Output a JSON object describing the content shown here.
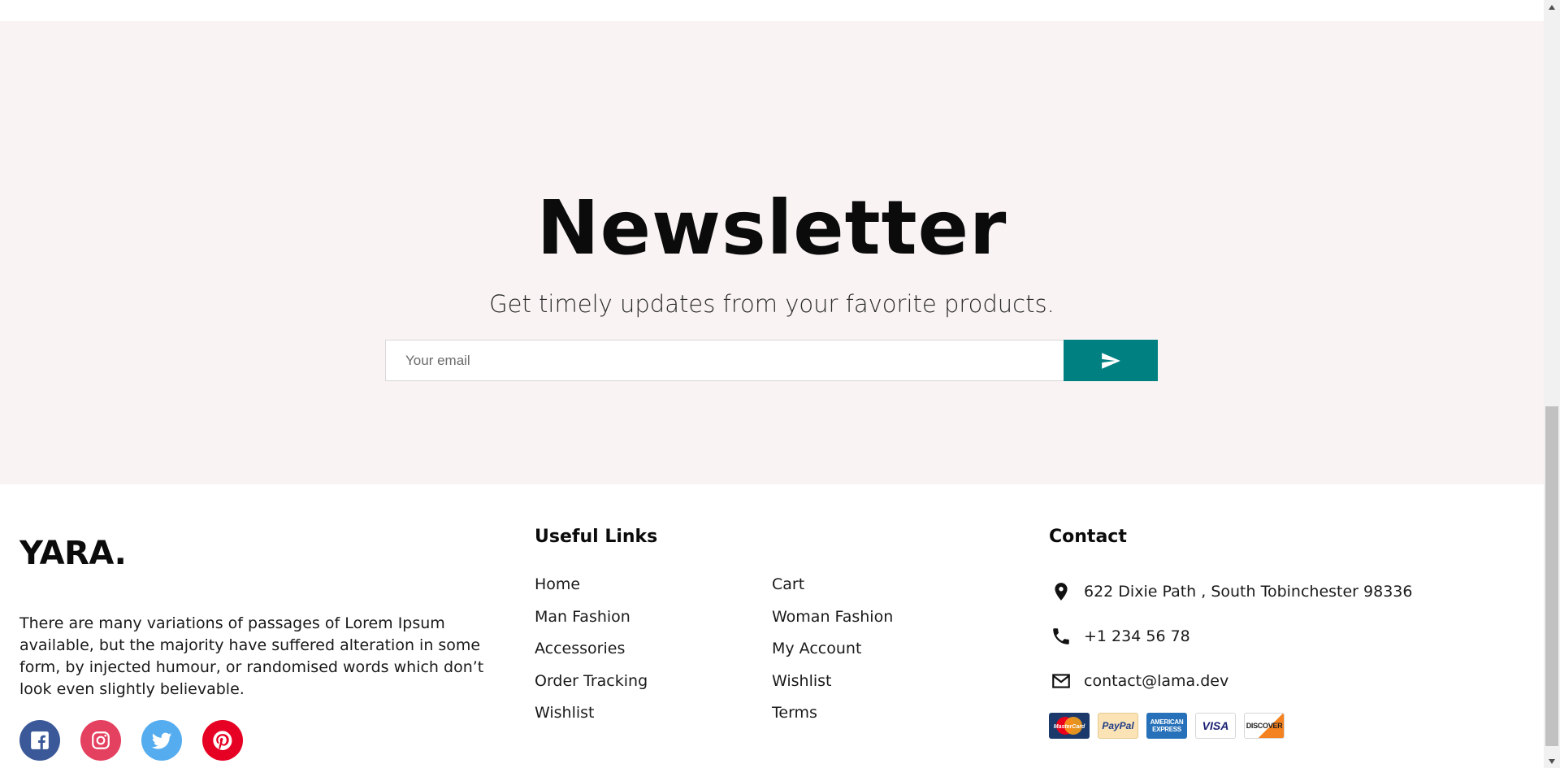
{
  "newsletter": {
    "title": "Newsletter",
    "description": "Get timely updates from your favorite products.",
    "email_placeholder": "Your email",
    "send_icon": "send-icon",
    "background": "#f9f3f3",
    "button_color": "#008080"
  },
  "footer": {
    "logo": "YARA.",
    "about": "There are many variations of passages of Lorem Ipsum available, but the majority have suffered alteration in some form, by injected humour, or randomised words which don’t look even slightly believable.",
    "socials": [
      {
        "name": "facebook",
        "color": "#3b5999"
      },
      {
        "name": "instagram",
        "color": "#e4405f"
      },
      {
        "name": "twitter",
        "color": "#55acee"
      },
      {
        "name": "pinterest",
        "color": "#e60023"
      }
    ],
    "links_title": "Useful Links",
    "links_left": [
      "Home",
      "Man Fashion",
      "Accessories",
      "Order Tracking",
      "Wishlist"
    ],
    "links_right": [
      "Cart",
      "Woman Fashion",
      "My Account",
      "Wishlist",
      "Terms"
    ],
    "contact_title": "Contact",
    "contact": {
      "address": "622 Dixie Path , South Tobinchester 98336",
      "phone": "+1 234 56 78",
      "email": "contact@lama.dev"
    },
    "payment_methods": [
      "MasterCard",
      "PayPal",
      "AMERICAN EXPRESS",
      "VISA",
      "DISCOVER"
    ]
  }
}
